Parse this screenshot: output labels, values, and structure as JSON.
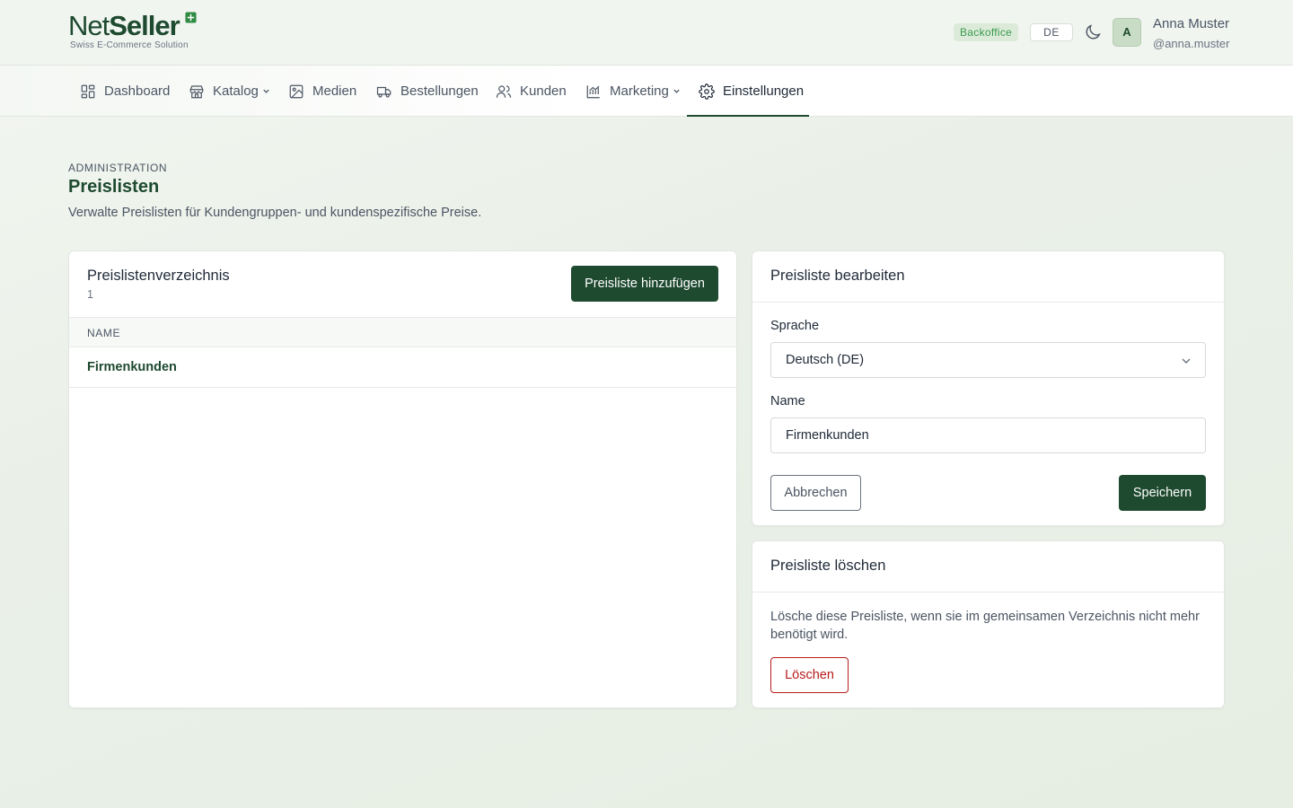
{
  "brand": {
    "logo_text_net": "Net",
    "logo_text_seller": "Seller",
    "tagline": "Swiss E-Commerce Solution",
    "color": "#1e4a2f"
  },
  "header": {
    "env_badge": "Backoffice",
    "language": "DE",
    "theme_icon": "moon-icon",
    "avatar_initial": "A",
    "user_name": "Anna Muster",
    "user_handle": "@anna.muster"
  },
  "nav": {
    "items": [
      {
        "label": "Dashboard",
        "icon": "dashboard-icon"
      },
      {
        "label": "Katalog",
        "icon": "store-icon",
        "has_dropdown": true
      },
      {
        "label": "Medien",
        "icon": "image-icon"
      },
      {
        "label": "Bestellungen",
        "icon": "truck-icon"
      },
      {
        "label": "Kunden",
        "icon": "users-icon"
      },
      {
        "label": "Marketing",
        "icon": "chart-icon",
        "has_dropdown": true
      },
      {
        "label": "Einstellungen",
        "icon": "gear-icon",
        "active": true
      }
    ]
  },
  "page": {
    "eyebrow": "ADMINISTRATION",
    "title": "Preislisten",
    "description": "Verwalte Preislisten für Kundengruppen- und kundenspezifische Preise."
  },
  "list": {
    "title": "Preislistenverzeichnis",
    "count": "1",
    "add_button": "Preisliste hinzufügen",
    "columns": [
      "NAME"
    ],
    "rows": [
      {
        "name": "Firmenkunden"
      }
    ]
  },
  "edit": {
    "title": "Preisliste bearbeiten",
    "language_label": "Sprache",
    "language_value": "Deutsch (DE)",
    "name_label": "Name",
    "name_value": "Firmenkunden",
    "cancel_button": "Abbrechen",
    "save_button": "Speichern"
  },
  "delete": {
    "title": "Preisliste löschen",
    "description": "Lösche diese Preisliste, wenn sie im gemeinsamen Verzeichnis nicht mehr benötigt wird.",
    "delete_button": "Löschen",
    "danger_color": "#b91c1c"
  }
}
